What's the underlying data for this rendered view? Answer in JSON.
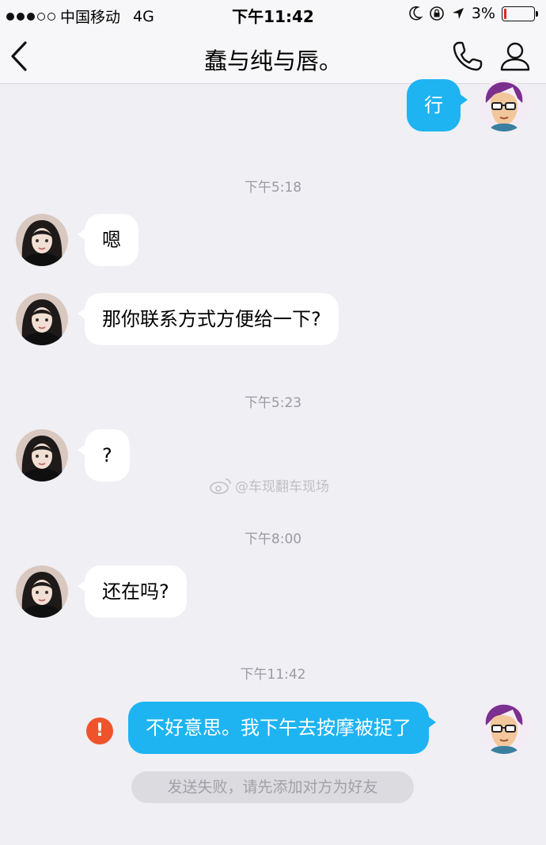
{
  "status_bar": {
    "carrier": "中国移动",
    "network": "4G",
    "time": "下午11:42",
    "battery_percent": "3%",
    "battery_level": 0.03
  },
  "nav": {
    "title": "蠢与纯与唇。"
  },
  "messages": [
    {
      "text": "行"
    },
    {
      "timestamp": "下午5:18"
    },
    {
      "text": "嗯"
    },
    {
      "text": "那你联系方式方便给一下?"
    },
    {
      "timestamp": "下午5:23"
    },
    {
      "text": "?"
    },
    {
      "timestamp": "下午8:00"
    },
    {
      "text": "还在吗?"
    },
    {
      "timestamp": "下午11:42"
    },
    {
      "text": "不好意思。我下午去按摩被捉了"
    }
  ],
  "watermark": "@车现翻车现场",
  "failure": {
    "icon": "!",
    "notice": "发送失败，请先添加对方为好友"
  },
  "colors": {
    "background": "#efeff4",
    "outgoing_bubble": "#1eb4f2",
    "incoming_bubble": "#ffffff",
    "error": "#f0532b"
  }
}
